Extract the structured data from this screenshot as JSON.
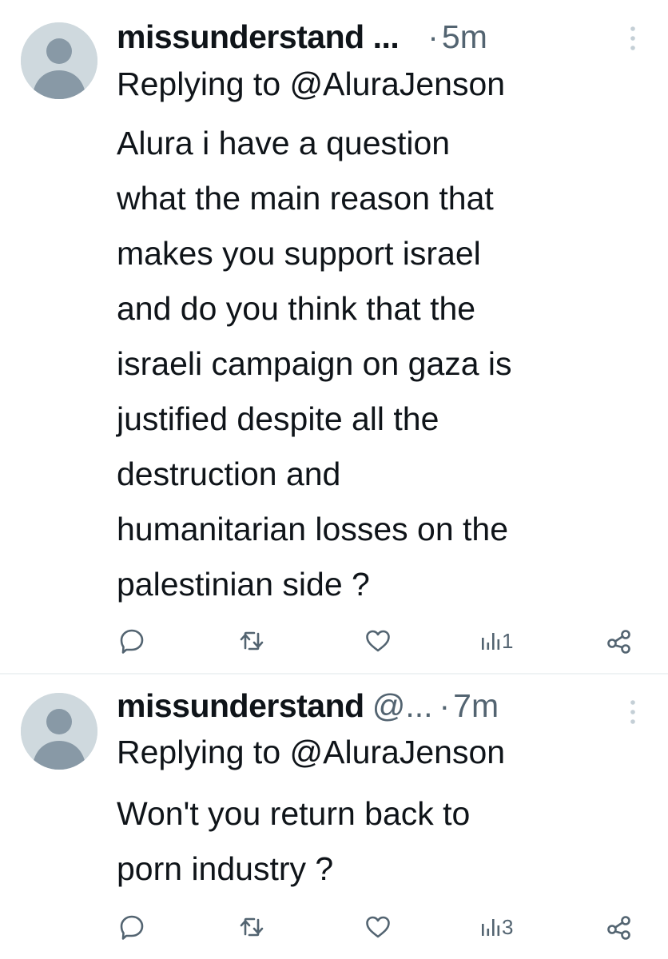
{
  "tweets": [
    {
      "display_name": "missunderstand ...",
      "handle": "",
      "separator": "·",
      "time": "5m",
      "replying_to": "Replying to @AluraJenson",
      "text_lines": [
        "Alura i have a question",
        "what the main reason that",
        "makes you support israel",
        "and do you think that the",
        "israeli campaign on gaza is",
        "justified despite all the",
        "destruction and",
        "humanitarian losses on the",
        "palestinian side ?"
      ],
      "views": "1"
    },
    {
      "display_name": "missunderstand",
      "handle": "@...",
      "separator": "·",
      "time": "7m",
      "replying_to": "Replying to @AluraJenson",
      "text_lines": [
        "Won't you return back to",
        "porn industry ?"
      ],
      "views": "3"
    }
  ],
  "icons": {
    "reply": "reply-icon",
    "retweet": "retweet-icon",
    "like": "like-icon",
    "views": "views-icon",
    "share": "share-icon",
    "more": "more-vertical-icon",
    "avatar": "default-avatar-icon"
  },
  "colors": {
    "text_primary": "#0f1419",
    "text_secondary": "#536471",
    "avatar_bg": "#cfd9de",
    "avatar_fg": "#8899a6",
    "divider": "#eff3f4"
  }
}
